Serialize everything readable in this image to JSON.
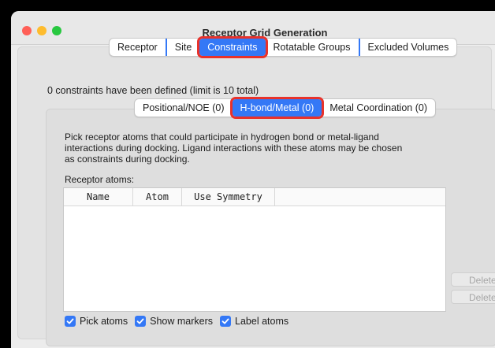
{
  "window": {
    "title": "Receptor Grid Generation"
  },
  "main_tabs": [
    {
      "label": "Receptor"
    },
    {
      "label": "Site"
    },
    {
      "label": "Constraints"
    },
    {
      "label": "Rotatable Groups"
    },
    {
      "label": "Excluded Volumes"
    }
  ],
  "constraints": {
    "summary": "0 constraints have been defined (limit is 10 total)",
    "sub_tabs": [
      {
        "label": "Positional/NOE (0)"
      },
      {
        "label": "H-bond/Metal (0)"
      },
      {
        "label": "Metal Coordination (0)"
      }
    ]
  },
  "hbond": {
    "description": "Pick receptor atoms that could participate in hydrogen bond or metal-ligand interactions during docking. Ligand interactions with these atoms may be chosen as constraints during docking.",
    "atoms_label": "Receptor atoms:",
    "columns": [
      "Name",
      "Atom",
      "Use Symmetry"
    ],
    "delete_label": "Delete",
    "delete_all_label": "Delete All",
    "checks": [
      {
        "label": "Pick atoms",
        "checked": true
      },
      {
        "label": "Show markers",
        "checked": true
      },
      {
        "label": "Label atoms",
        "checked": true
      }
    ]
  },
  "colors": {
    "accent": "#3478f6",
    "highlight": "#e8322b"
  }
}
